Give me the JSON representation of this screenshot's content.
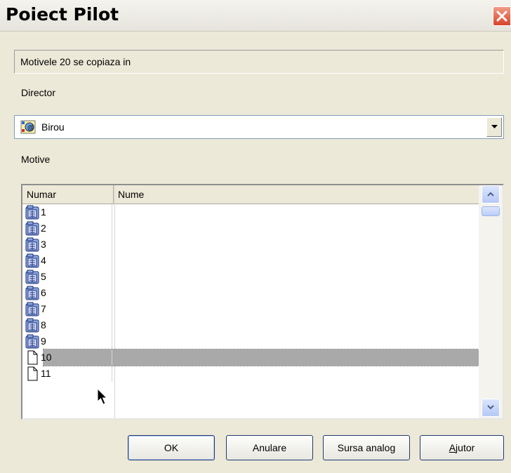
{
  "window": {
    "title": "Poiect Pilot",
    "close_icon": "close-icon"
  },
  "info_text": "Motivele 20 se copiaza in",
  "director": {
    "label": "Director",
    "selected": "Birou",
    "icon": "desktop-icon"
  },
  "motive": {
    "label": "Motive",
    "columns": [
      "Numar",
      "Nume"
    ],
    "rows": [
      {
        "num": "1",
        "name": "",
        "icon": "folder-list-icon"
      },
      {
        "num": "2",
        "name": "",
        "icon": "folder-list-icon"
      },
      {
        "num": "3",
        "name": "",
        "icon": "folder-list-icon"
      },
      {
        "num": "4",
        "name": "",
        "icon": "folder-list-icon"
      },
      {
        "num": "5",
        "name": "",
        "icon": "folder-list-icon"
      },
      {
        "num": "6",
        "name": "",
        "icon": "folder-list-icon"
      },
      {
        "num": "7",
        "name": "",
        "icon": "folder-list-icon"
      },
      {
        "num": "8",
        "name": "",
        "icon": "folder-list-icon"
      },
      {
        "num": "9",
        "name": "",
        "icon": "folder-list-icon"
      },
      {
        "num": "10",
        "name": "",
        "icon": "blank-page-icon",
        "selected": true
      },
      {
        "num": "11",
        "name": "",
        "icon": "blank-page-icon"
      }
    ]
  },
  "buttons": {
    "ok": "OK",
    "cancel": "Anulare",
    "source": "Sursa analog",
    "help": "Ajutor"
  }
}
